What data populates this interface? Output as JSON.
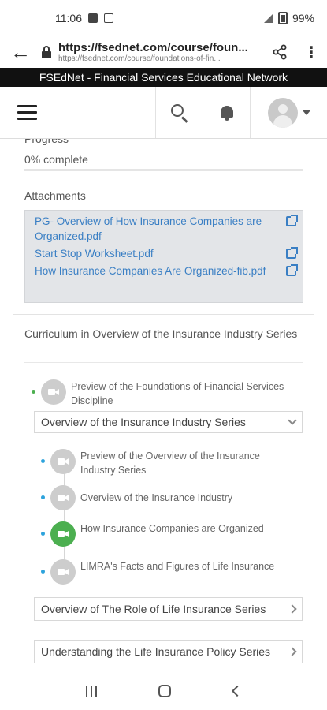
{
  "status_bar": {
    "time": "11:06",
    "battery": "99%"
  },
  "browser": {
    "url_title": "https://fsednet.com/course/foun...",
    "url_full": "https://fsednet.com/course/foundations-of-fin..."
  },
  "banner": {
    "text": "FSEdNet - Financial Services Educational Network"
  },
  "progress": {
    "label": "Progress",
    "text": "0% complete",
    "percent": 0
  },
  "attachments": {
    "title": "Attachments",
    "items": [
      {
        "name": "PG- Overview of How Insurance Companies are Organized.pdf"
      },
      {
        "name": "Start Stop Worksheet.pdf"
      },
      {
        "name": "How Insurance Companies Are Organized-fib.pdf"
      }
    ]
  },
  "curriculum": {
    "title": "Curriculum in Overview of the Insurance Industry Series",
    "preview": "Preview of the Foundations of Financial Services Discipline",
    "current_section": "Overview of the Insurance Industry Series",
    "lessons": [
      {
        "title": "Preview of the Overview of the Insurance Industry Series"
      },
      {
        "title": "Overview of the Insurance Industry"
      },
      {
        "title": "How Insurance Companies are Organized"
      },
      {
        "title": "LIMRA's Facts and Figures of Life Insurance"
      }
    ],
    "series": [
      {
        "title": "Overview of The Role of Life Insurance Series"
      },
      {
        "title": "Understanding the Life Insurance Policy Series"
      }
    ]
  },
  "colors": {
    "accent_green": "#4caf50",
    "link_blue": "#3a7fc4",
    "dot_blue": "#2da3dc"
  }
}
